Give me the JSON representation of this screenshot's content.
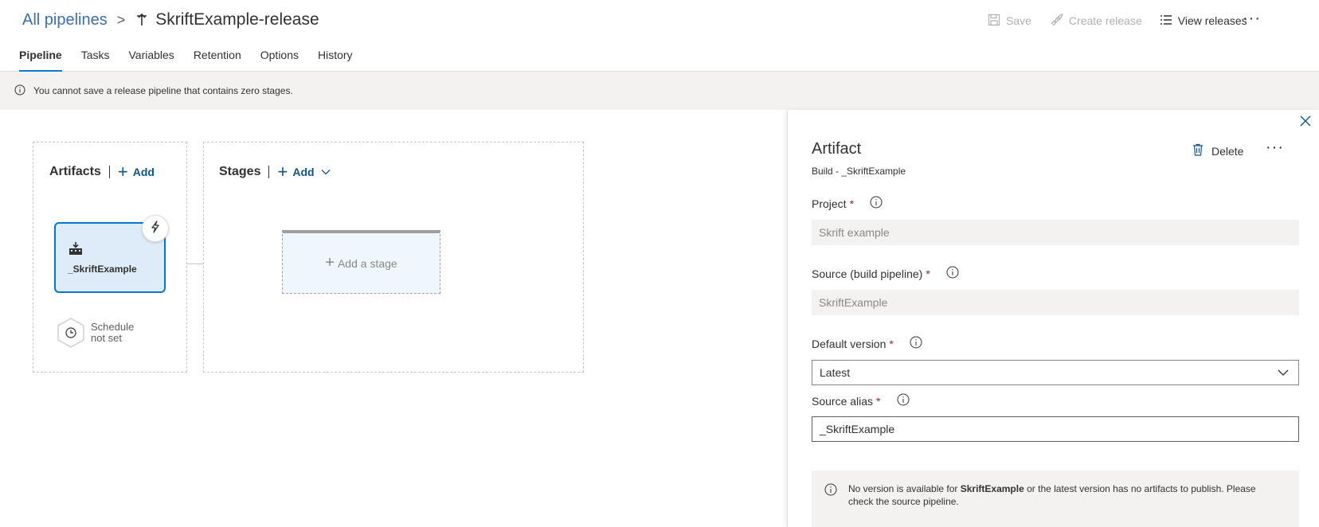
{
  "breadcrumb": {
    "root": "All pipelines",
    "separator": ">",
    "title": "SkriftExample-release"
  },
  "toolbar": {
    "save": "Save",
    "create_release": "Create release",
    "view_releases": "View releases",
    "more": "···"
  },
  "tabs": [
    {
      "label": "Pipeline",
      "active": true
    },
    {
      "label": "Tasks"
    },
    {
      "label": "Variables"
    },
    {
      "label": "Retention"
    },
    {
      "label": "Options"
    },
    {
      "label": "History"
    }
  ],
  "warning": {
    "text": "You cannot save a release pipeline that contains zero stages."
  },
  "canvas": {
    "artifacts_title": "Artifacts",
    "artifacts_add": "Add",
    "artifact_name": "_SkriftExample",
    "schedule_line1": "Schedule",
    "schedule_line2": "not set",
    "stages_title": "Stages",
    "stages_add": "Add",
    "add_stage": "Add a stage"
  },
  "panel": {
    "title": "Artifact",
    "subtitle": "Build - _SkriftExample",
    "delete": "Delete",
    "more": "···",
    "project_label": "Project",
    "project_value": "Skrift example",
    "source_label": "Source (build pipeline)",
    "source_value": "SkriftExample",
    "version_label": "Default version",
    "version_value": "Latest",
    "alias_label": "Source alias",
    "alias_value": "_SkriftExample",
    "required_mark": "*",
    "notice_pre": "No version is available for ",
    "notice_bold": "SkriftExample",
    "notice_post": " or the latest version has no artifacts to publish. Please check the source pipeline."
  },
  "colors": {
    "accent": "#0078d4",
    "link": "#0f548c",
    "required": "#a4262c",
    "card_bg": "#deecf9",
    "stage_bg": "#eff6fc"
  },
  "icons": [
    "pipeline-icon",
    "save-icon",
    "rocket-icon",
    "list-icon",
    "info-icon",
    "plus-icon",
    "build-icon",
    "lightning-icon",
    "clock-icon",
    "chevron-down-icon",
    "trash-icon",
    "close-icon"
  ]
}
